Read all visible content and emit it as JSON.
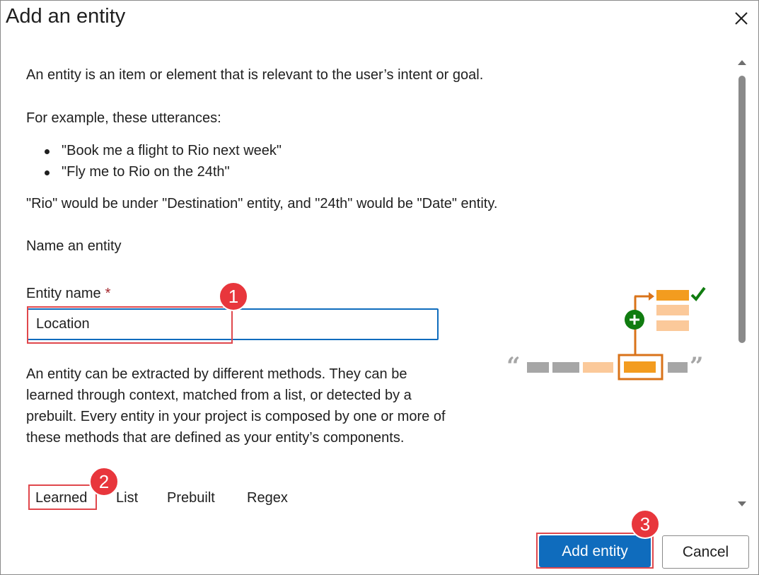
{
  "dialog": {
    "title": "Add an entity",
    "close_icon": "close-icon"
  },
  "content": {
    "intro": "An entity is an item or element that is relevant to the user’s intent or goal.",
    "example_lead": "For example, these utterances:",
    "examples": [
      "\"Book me a flight to Rio next week\"",
      "\"Fly me to Rio on the 24th\""
    ],
    "explanation": "\"Rio\" would be under \"Destination\" entity, and \"24th\" would be \"Date\" entity.",
    "section_heading": "Name an entity",
    "field_label": "Entity name",
    "required_marker": "*",
    "field_value": "Location",
    "methods_description": "An entity can be extracted by different methods. They can be learned through context, matched from a list, or detected by a prebuilt. Every entity in your project is composed by one or more of these methods that are defined as your entity’s components.",
    "method_tabs": [
      "Learned",
      "List",
      "Prebuilt",
      "Regex"
    ]
  },
  "callouts": [
    "1",
    "2",
    "3"
  ],
  "footer": {
    "primary_label": "Add entity",
    "secondary_label": "Cancel"
  },
  "colors": {
    "accent": "#0f6cbd",
    "callout": "#e8363c",
    "illustration_orange": "#f39c1f",
    "illustration_light": "#fbc99a",
    "illustration_green": "#107c10"
  }
}
